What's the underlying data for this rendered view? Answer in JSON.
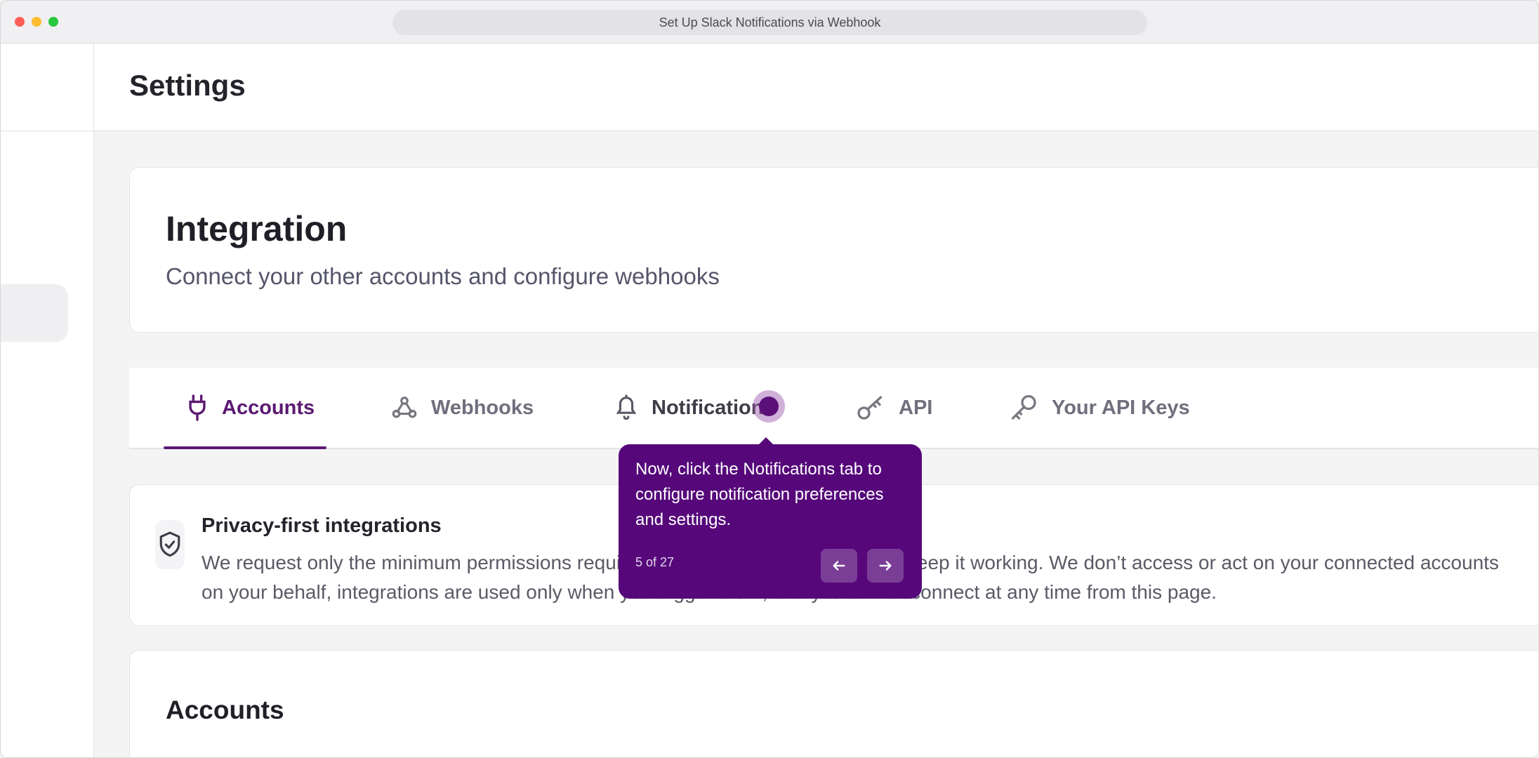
{
  "window": {
    "title": "Set Up Slack Notifications via Webhook"
  },
  "header": {
    "title": "Settings"
  },
  "integration": {
    "title": "Integration",
    "subtitle": "Connect your other accounts and configure webhooks"
  },
  "tabs": [
    {
      "label": "Accounts",
      "icon": "plug-icon",
      "active": true
    },
    {
      "label": "Webhooks",
      "icon": "webhook-icon",
      "active": false
    },
    {
      "label": "Notifications",
      "icon": "bell-icon",
      "active": false
    },
    {
      "label": "API",
      "icon": "key-icon",
      "active": false
    },
    {
      "label": "Your API Keys",
      "icon": "key-icon",
      "active": false
    }
  ],
  "privacy": {
    "title": "Privacy-first integrations",
    "line1": "We request only the minimum permissions required to connect your account and keep it working. We don’t access or act on your connected accounts",
    "line2": "on your behalf, integrations are used only when you trigger them, and you can disconnect at any time from this page."
  },
  "accounts_section": {
    "title": "Accounts"
  },
  "tooltip": {
    "message": "Now, click the Notifications tab to configure notification preferences and settings.",
    "step": "5 of 27"
  },
  "colors": {
    "accent": "#5b1a72",
    "tooltip_bg": "#56087a"
  }
}
